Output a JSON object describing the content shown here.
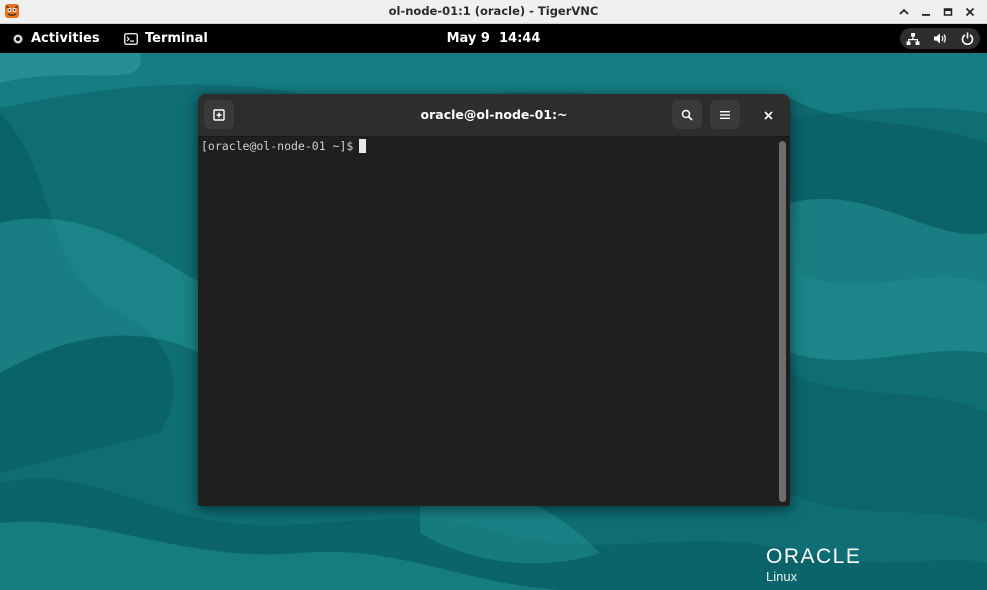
{
  "vnc": {
    "title": "ol-node-01:1 (oracle) - TigerVNC",
    "icon": "tigervnc-icon",
    "controls": [
      "chevron-up-icon",
      "minimize-icon",
      "maximize-icon",
      "close-icon"
    ]
  },
  "topbar": {
    "activities_label": "Activities",
    "app_label": "Terminal",
    "clock": "May 9  14:44",
    "tray_icons": [
      "network-icon",
      "volume-icon",
      "power-icon"
    ]
  },
  "terminal": {
    "title": "oracle@ol-node-01:~",
    "prompt": "[oracle@ol-node-01 ~]$",
    "buttons": [
      "new-tab-icon",
      "search-icon",
      "menu-icon",
      "close-icon"
    ]
  },
  "branding": {
    "logo_word": "ORACLE",
    "logo_sub": "Linux"
  },
  "colors": {
    "wallpaper_base": "#0f6f75",
    "terminal_bg": "#1f1f1f",
    "headerbar_bg": "#2d2d2d"
  }
}
